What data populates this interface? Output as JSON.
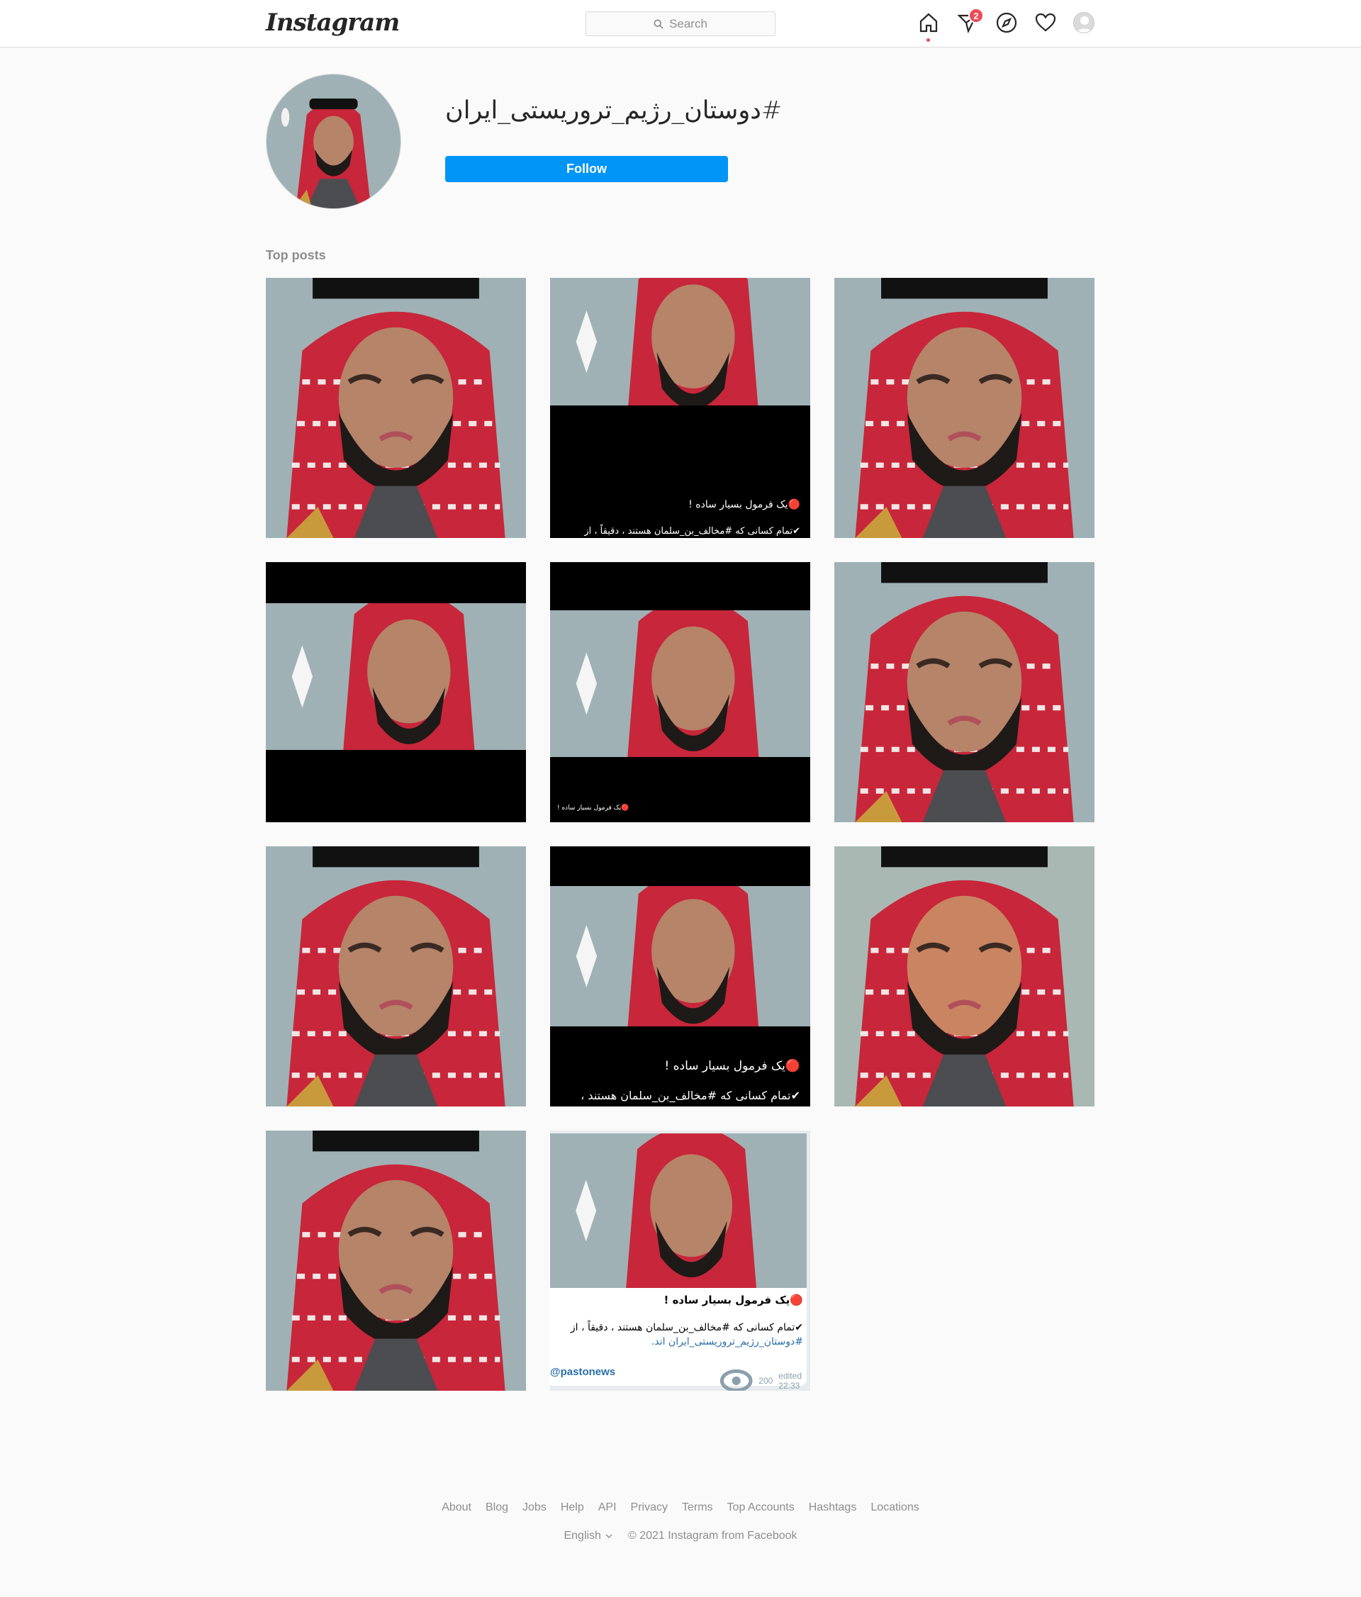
{
  "header": {
    "logo": "Instagram",
    "search_placeholder": "Search",
    "dm_badge": "2"
  },
  "hashtag": {
    "title": "#دوستان_رژیم_تروریستی_ایران",
    "follow_label": "Follow"
  },
  "top_posts_label": "Top posts",
  "posts": [
    {
      "variant": "portrait"
    },
    {
      "variant": "text-card",
      "caption_line1": "🔴یک فرمول بسیار ساده !",
      "caption_line2": "✔تمام کسانی که #مخالف_بن_سلمان هستند ، دقیقاً ، از"
    },
    {
      "variant": "portrait"
    },
    {
      "variant": "letterbox"
    },
    {
      "variant": "letterbox-caption",
      "caption_line1": "🔴یک فرمول بسیار ساده !"
    },
    {
      "variant": "portrait"
    },
    {
      "variant": "portrait"
    },
    {
      "variant": "text-card",
      "caption_line1": "🔴یک فرمول بسیار ساده !",
      "caption_line2": "✔تمام کسانی که #مخالف_بن_سلمان هستند ،"
    },
    {
      "variant": "portrait-warm"
    },
    {
      "variant": "portrait"
    },
    {
      "variant": "telegram",
      "caption_line1": "🔴یک فرمول بسیار ساده !",
      "caption_line2": "✔تمام کسانی که #مخالف_بن_سلمان هستند ، دقیقاً ، از",
      "caption_line3": "#دوستان_رژیم_تروریستی_ایران اند.",
      "channel": "@pastonews",
      "views": "200",
      "edited": "edited 22:33"
    }
  ],
  "footer": {
    "links": [
      "About",
      "Blog",
      "Jobs",
      "Help",
      "API",
      "Privacy",
      "Terms",
      "Top Accounts",
      "Hashtags",
      "Locations"
    ],
    "language": "English",
    "copyright": "© 2021 Instagram from Facebook"
  },
  "colors": {
    "accent": "#0095f6",
    "badge": "#ed4956",
    "sky": "#8fa3a8",
    "headdress_red": "#c8263a"
  }
}
